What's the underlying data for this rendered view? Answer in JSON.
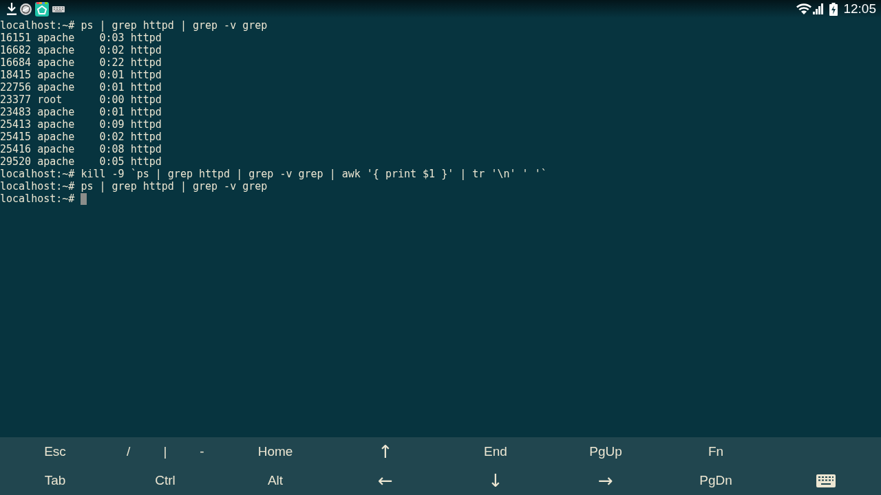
{
  "status_bar": {
    "time": "12:05"
  },
  "terminal": {
    "lines": [
      "localhost:~# ps | grep httpd | grep -v grep",
      "16151 apache    0:03 httpd",
      "16682 apache    0:02 httpd",
      "16684 apache    0:22 httpd",
      "18415 apache    0:01 httpd",
      "22756 apache    0:01 httpd",
      "23377 root      0:00 httpd",
      "23483 apache    0:01 httpd",
      "25413 apache    0:09 httpd",
      "25415 apache    0:02 httpd",
      "25416 apache    0:08 httpd",
      "29520 apache    0:05 httpd",
      "localhost:~# kill -9 `ps | grep httpd | grep -v grep | awk '{ print $1 }' | tr '\\n' ' '`",
      "localhost:~# ps | grep httpd | grep -v grep",
      "localhost:~#"
    ],
    "cursor_visible": true
  },
  "extra_keys": {
    "rows": [
      [
        {
          "kind": "key",
          "label": "Esc"
        },
        {
          "kind": "group",
          "keys": [
            {
              "label": "/"
            },
            {
              "label": "|"
            },
            {
              "label": "-"
            }
          ]
        },
        {
          "kind": "key",
          "label": "Home"
        },
        {
          "kind": "arrow",
          "label": "↑"
        },
        {
          "kind": "key",
          "label": "End"
        },
        {
          "kind": "key",
          "label": "PgUp"
        },
        {
          "kind": "key",
          "label": "Fn"
        }
      ],
      [
        {
          "kind": "key",
          "label": "Tab"
        },
        {
          "kind": "key",
          "label": "Ctrl"
        },
        {
          "kind": "key",
          "label": "Alt"
        },
        {
          "kind": "arrow",
          "label": "←"
        },
        {
          "kind": "arrow",
          "label": "↓"
        },
        {
          "kind": "arrow",
          "label": "→"
        },
        {
          "kind": "key",
          "label": "PgDn"
        },
        {
          "kind": "keyboard"
        }
      ]
    ]
  }
}
